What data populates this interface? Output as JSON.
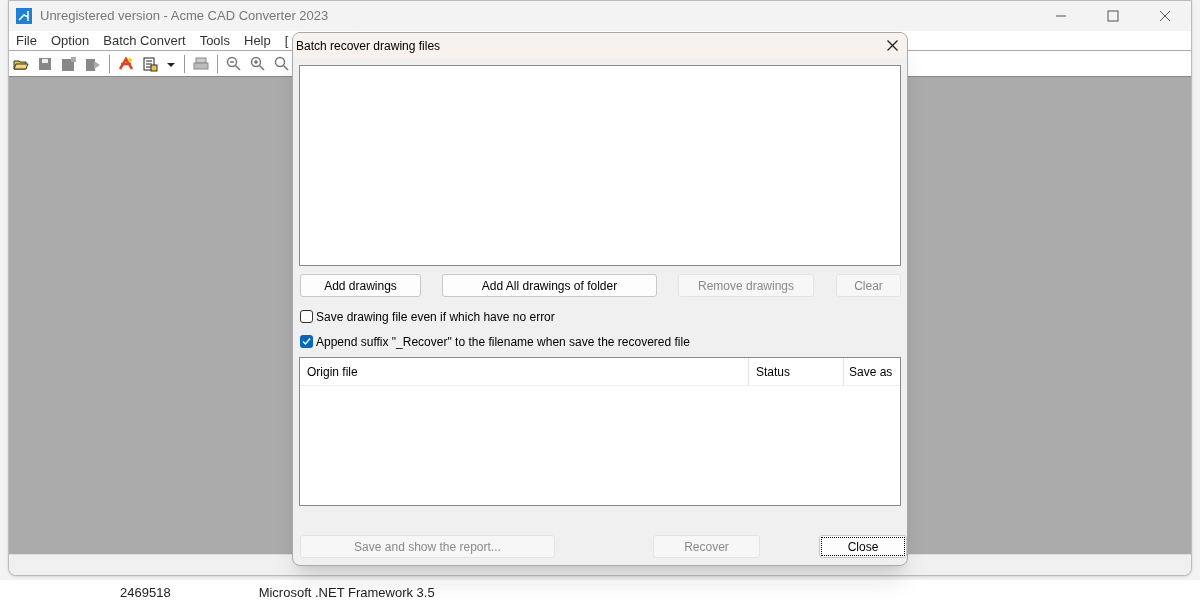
{
  "window": {
    "title": "Unregistered version - Acme CAD Converter 2023"
  },
  "menu": [
    "File",
    "Option",
    "Batch Convert",
    "Tools",
    "Help",
    "["
  ],
  "dialog": {
    "title": "Batch recover drawing files",
    "buttons": [
      {
        "label": "Add drawings",
        "disabled": false
      },
      {
        "label": "Add All drawings of folder",
        "disabled": false
      },
      {
        "label": "Remove drawings",
        "disabled": true
      },
      {
        "label": "Clear",
        "disabled": true
      }
    ],
    "options": [
      {
        "label": "Save drawing file even if which have no error",
        "checked": false
      },
      {
        "label": "Append suffix \"_Recover\" to the filename when save the recovered file",
        "checked": true
      }
    ],
    "table": {
      "columns": [
        "Origin file",
        "Status",
        "Save as"
      ]
    },
    "footer_buttons": [
      {
        "label": "Save and show the report...",
        "disabled": true
      },
      {
        "label": "Recover",
        "disabled": true
      },
      {
        "label": "Close",
        "disabled": false
      }
    ]
  },
  "background_window": {
    "cells": [
      "2469518",
      "Microsoft .NET Framework 3.5"
    ]
  }
}
